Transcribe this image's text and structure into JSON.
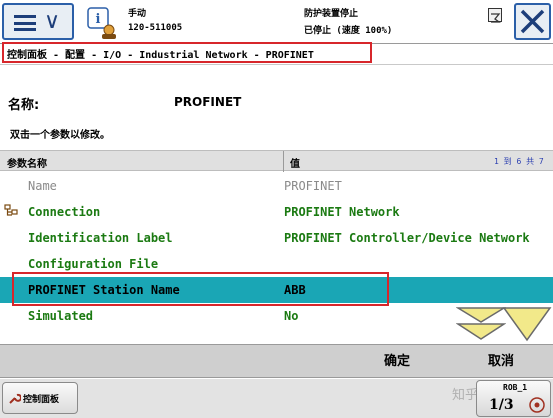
{
  "header": {
    "mode": "手动",
    "controller": "120-511005",
    "safety": "防护装置停止",
    "run_state": "已停止 (速度 100%)"
  },
  "breadcrumb": "控制面板 - 配置 - I/O - Industrial Network - PROFINET",
  "name_label": "名称:",
  "name_value": "PROFINET",
  "instruction": "双击一个参数以修改。",
  "table": {
    "col_param": "参数名称",
    "col_value": "值",
    "page_count": "1 到 6 共 7",
    "rows": [
      {
        "param": "Name",
        "value": "PROFINET"
      },
      {
        "param": "Connection",
        "value": "PROFINET Network"
      },
      {
        "param": "Identification Label",
        "value": "PROFINET Controller/Device Network"
      },
      {
        "param": "Configuration File",
        "value": ""
      },
      {
        "param": "PROFINET Station Name",
        "value": "ABB"
      },
      {
        "param": "Simulated",
        "value": "No"
      }
    ]
  },
  "buttons": {
    "ok": "确定",
    "cancel": "取消"
  },
  "taskbar": {
    "control_panel": "控制面板",
    "quickset_top": "ROB_1",
    "quickset_fraction": "1/3",
    "watermark": "知乎 @米哥"
  },
  "colors": {
    "accent_blue": "#2b5fa8",
    "selected_row": "#1aa6b5",
    "param_green": "#1b7a12",
    "highlight_red": "#d7262b"
  }
}
